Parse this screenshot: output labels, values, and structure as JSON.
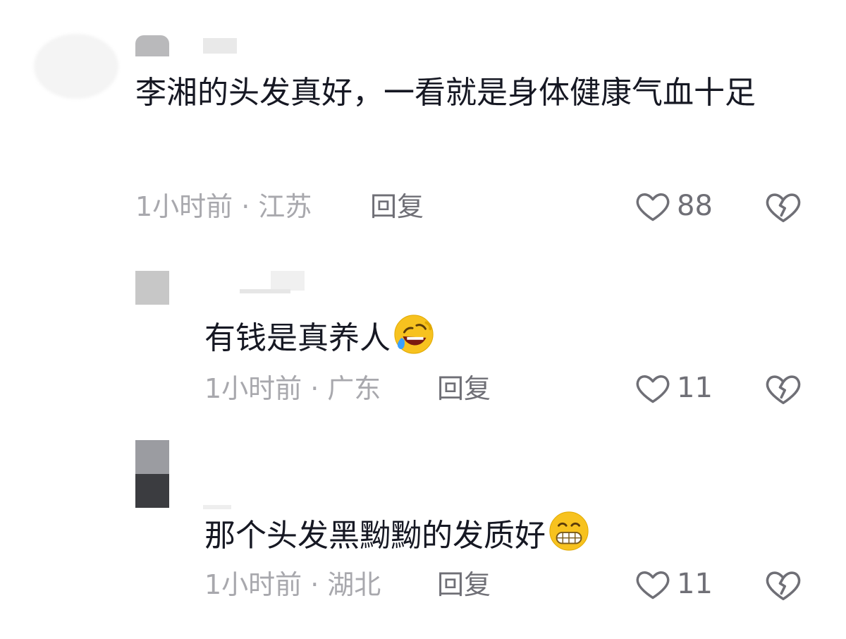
{
  "comments": [
    {
      "text": "李湘的头发真好，一看就是身体健康气血十足",
      "time": "1小时前",
      "location": "江苏",
      "reply_label": "回复",
      "likes": "88"
    },
    {
      "text": "有钱是真养人",
      "emoji": "face-with-tears-of-joy-icon",
      "time": "1小时前",
      "location": "广东",
      "reply_label": "回复",
      "likes": "11"
    },
    {
      "text": "那个头发黑黝黝的发质好",
      "emoji": "grinning-face-icon",
      "time": "1小时前",
      "location": "湖北",
      "reply_label": "回复",
      "likes": "11"
    }
  ],
  "separator": "·",
  "colors": {
    "text": "#161823",
    "meta": "#a8a8ad",
    "action": "#6f6f76",
    "emoji_yellow": "#f7c21f",
    "emoji_tear": "#3aa0ff"
  }
}
